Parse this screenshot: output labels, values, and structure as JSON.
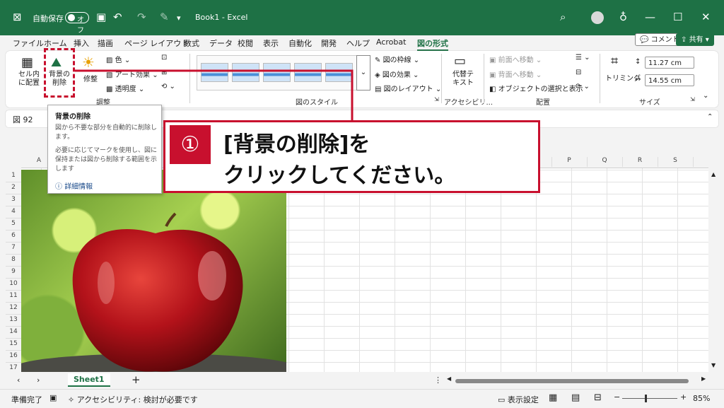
{
  "titlebar": {
    "autosave": "自動保存",
    "autosave_state": "オフ",
    "doc_title": "Book1  -  Excel"
  },
  "tabs": [
    "ファイル",
    "ホーム",
    "挿入",
    "描画",
    "ページ レイアウト",
    "数式",
    "データ",
    "校閲",
    "表示",
    "自動化",
    "開発",
    "ヘルプ",
    "Acrobat",
    "図の形式"
  ],
  "active_tab": "図の形式",
  "header_buttons": {
    "comment": "コメント",
    "share": "共有"
  },
  "ribbon": {
    "fit_cell": "セル内\nに配置",
    "remove_bg": "背景の\n削除",
    "corrections": "修整",
    "color": "色",
    "art_effects": "アート効果",
    "transparency": "透明度",
    "adjust_group": "調整",
    "style_group": "図のスタイル",
    "border": "図の枠線",
    "effects": "図の効果",
    "layout": "図のレイアウト",
    "alt_text": "代替テ\nキスト",
    "accessibility_group": "アクセシビリ...",
    "bring_forward": "前面へ移動",
    "send_backward": "背面へ移動",
    "selection_pane": "オブジェクトの選択と表示",
    "arrange_group": "配置",
    "crop": "トリミング",
    "height": "11.27 cm",
    "width": "14.55 cm",
    "size_group": "サイズ"
  },
  "namebox": "図 92",
  "columns": [
    "A",
    "N",
    "O",
    "P",
    "Q",
    "R",
    "S"
  ],
  "rows": [
    "1",
    "2",
    "3",
    "4",
    "5",
    "6",
    "7",
    "8",
    "9",
    "10",
    "11",
    "12",
    "13",
    "14",
    "15",
    "16",
    "17"
  ],
  "tooltip": {
    "title": "背景の削除",
    "p1": "図から不要な部分を自動的に削除します。",
    "p2": "必要に応じてマークを使用し、図に保持または図から削除する範囲を示します",
    "link": "詳細情報"
  },
  "callout": {
    "number": "①",
    "line1": "[背景の削除]を",
    "line2": "クリックしてください。"
  },
  "sheet_tab": "Sheet1",
  "status": {
    "ready": "準備完了",
    "accessibility": "アクセシビリティ: 検討が必要です",
    "display_settings": "表示設定",
    "zoom": "85%"
  },
  "colors": {
    "excel_green": "#1e7145",
    "callout_red": "#c8102e"
  }
}
